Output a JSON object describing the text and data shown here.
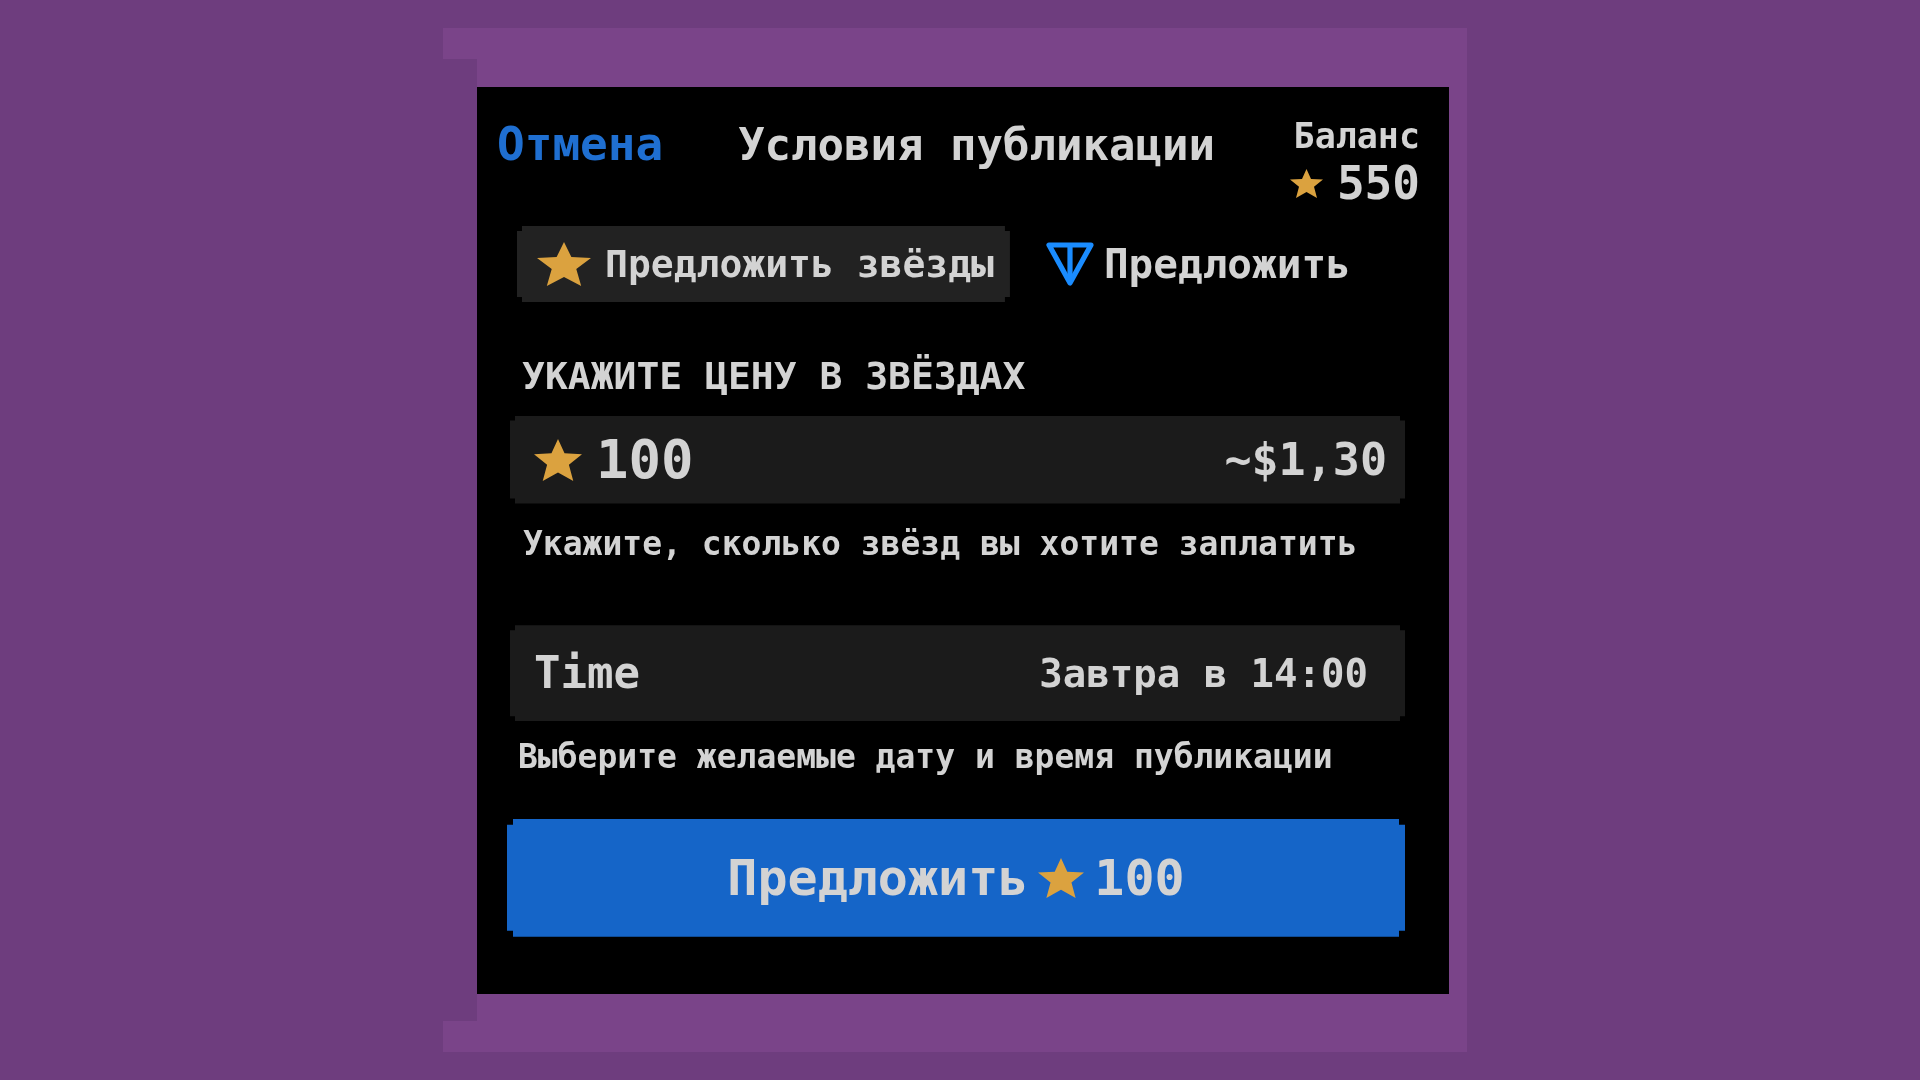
{
  "header": {
    "cancel": "Отмена",
    "title": "Условия публикации",
    "balance": {
      "label": "Баланс",
      "value": "550"
    }
  },
  "tabs": [
    {
      "label": "Предложить звёзды",
      "kind": "star",
      "selected": true
    },
    {
      "label": "Предложить",
      "kind": "ton",
      "selected": false
    }
  ],
  "price": {
    "heading": "УКАЖИТЕ ЦЕНУ В ЗВЁЗДАХ",
    "value": "100",
    "conversion": "~$1,30",
    "hint": "Укажите, сколько звёзд вы хотите заплатить"
  },
  "schedule": {
    "label": "Time",
    "value": "Завтра в 14:00",
    "hint": "Выберите желаемые дату и время публикации"
  },
  "submit": {
    "label": "Предложить",
    "amount": "100"
  }
}
